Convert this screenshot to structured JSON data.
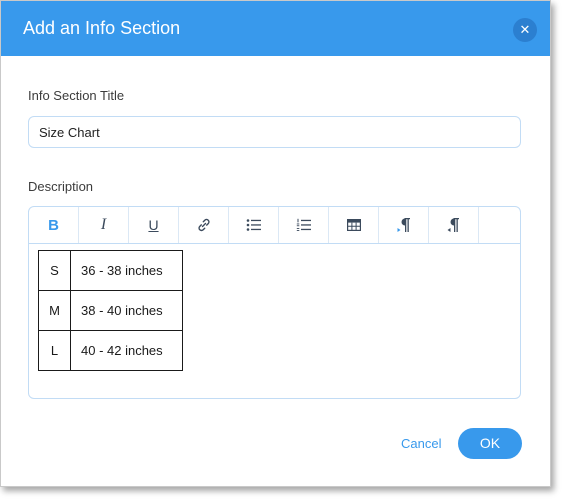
{
  "dialog": {
    "title": "Add an Info Section",
    "close_icon": "close-icon",
    "close_glyph": "✕"
  },
  "title_field": {
    "label": "Info Section Title",
    "value": "Size Chart"
  },
  "description": {
    "label": "Description",
    "toolbar": [
      {
        "name": "bold-button",
        "icon": "bold-icon",
        "glyph": "B"
      },
      {
        "name": "italic-button",
        "icon": "italic-icon",
        "glyph": "I"
      },
      {
        "name": "underline-button",
        "icon": "underline-icon",
        "glyph": "U"
      },
      {
        "name": "link-button",
        "icon": "link-icon",
        "glyph": ""
      },
      {
        "name": "bullet-list-button",
        "icon": "bullet-list-icon",
        "glyph": ""
      },
      {
        "name": "numbered-list-button",
        "icon": "numbered-list-icon",
        "glyph": ""
      },
      {
        "name": "table-button",
        "icon": "table-icon",
        "glyph": ""
      },
      {
        "name": "ltr-button",
        "icon": "ltr-paragraph-icon",
        "glyph": ""
      },
      {
        "name": "rtl-button",
        "icon": "rtl-paragraph-icon",
        "glyph": ""
      }
    ],
    "table": [
      {
        "size": "S",
        "range": "36 - 38 inches"
      },
      {
        "size": "M",
        "range": "38 - 40 inches"
      },
      {
        "size": "L",
        "range": "40 - 42 inches"
      }
    ]
  },
  "footer": {
    "cancel_label": "Cancel",
    "ok_label": "OK"
  },
  "colors": {
    "accent": "#3899ec",
    "header_bg": "#3899ec",
    "input_border": "#c2dcf5"
  }
}
